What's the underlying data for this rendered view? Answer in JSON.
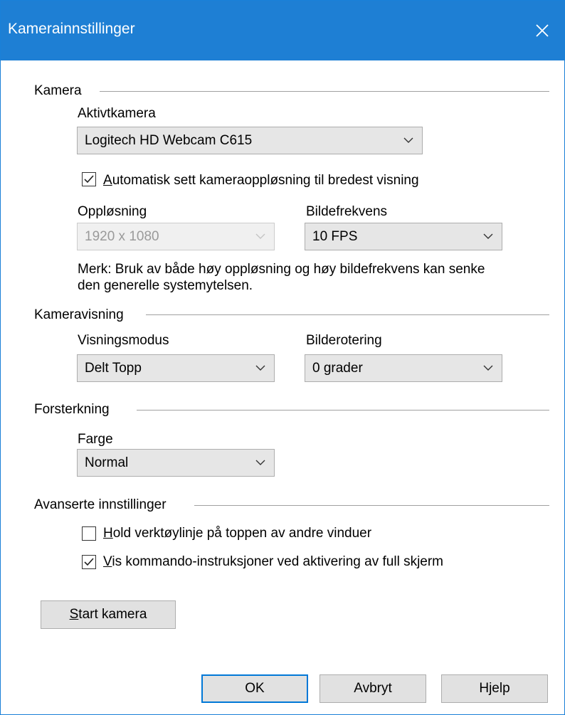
{
  "window": {
    "title": "Kamerainnstillinger"
  },
  "kamera": {
    "group_title": "Kamera",
    "active_camera_label": "Aktivtkamera",
    "active_camera_value": "Logitech HD Webcam C615",
    "auto_res_mnemonic": "A",
    "auto_res_rest": "utomatisk sett kameraoppløsning til bredest visning",
    "auto_res_checked": true,
    "resolution_label": "Oppløsning",
    "resolution_value": "1920 x 1080",
    "framerate_label": "Bildefrekvens",
    "framerate_value": "10 FPS",
    "note_line1": "Merk: Bruk av både høy oppløsning og høy bildefrekvens kan senke",
    "note_line2": "den generelle systemytelsen."
  },
  "visning": {
    "group_title": "Kameravisning",
    "mode_label": "Visningsmodus",
    "mode_value": "Delt Topp",
    "rotation_label": "Bilderotering",
    "rotation_value": "0 grader"
  },
  "forsterkning": {
    "group_title": "Forsterkning",
    "color_label": "Farge",
    "color_value": "Normal"
  },
  "avansert": {
    "group_title": "Avanserte innstillinger",
    "toolbar_mnemonic": "H",
    "toolbar_rest": "old verktøylinje på toppen av andre vinduer",
    "toolbar_checked": false,
    "fullscreen_mnemonic": "V",
    "fullscreen_rest": "is kommando-instruksjoner ved aktivering av full skjerm",
    "fullscreen_checked": true
  },
  "buttons": {
    "start_mnemonic": "S",
    "start_rest": "tart kamera",
    "ok": "OK",
    "cancel": "Avbryt",
    "help": "Hjelp"
  },
  "colors": {
    "accent": "#1e7fd4",
    "default_button_border": "#0078d7"
  }
}
